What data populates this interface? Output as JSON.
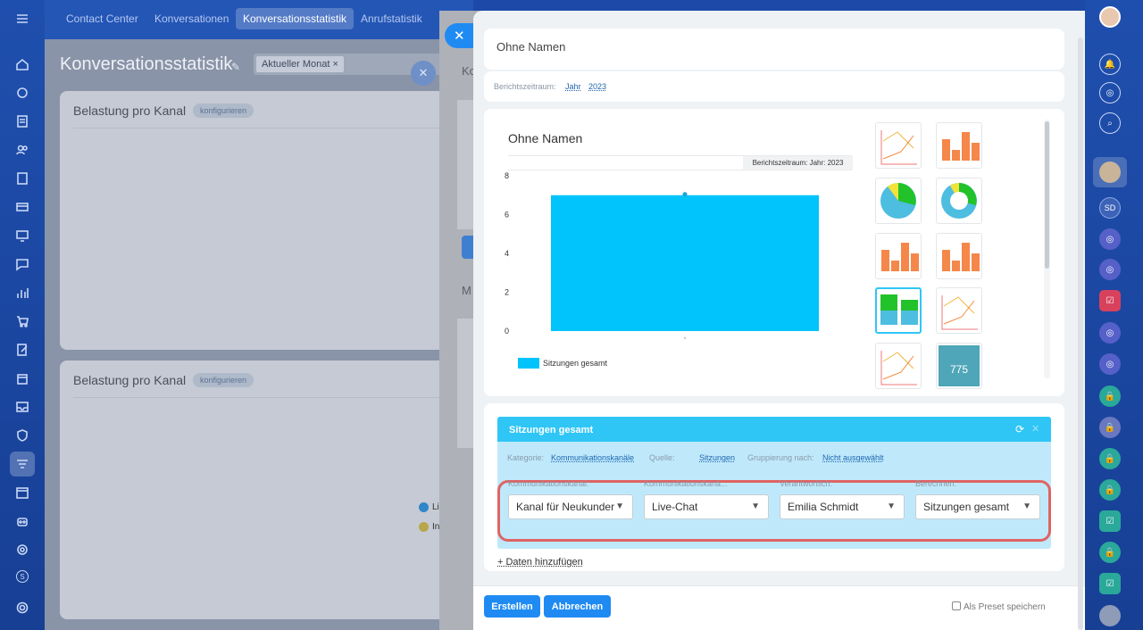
{
  "topnav": {
    "tabs": [
      {
        "label": "Contact Center"
      },
      {
        "label": "Konversationen"
      },
      {
        "label": "Konversationsstatistik"
      },
      {
        "label": "Anrufstatistik"
      }
    ]
  },
  "page": {
    "title": "Konversationsstatistik",
    "filter_chip": "Aktueller Monat",
    "panels": [
      {
        "title": "Belastung pro Kanal",
        "badge": "konfigurieren"
      },
      {
        "title": "Belastung pro Kanal",
        "badge": "konfigurieren"
      }
    ],
    "legend_partial": [
      "Li",
      "In"
    ],
    "behind_slider_letters": [
      "Ko",
      "M"
    ]
  },
  "report": {
    "name_input": "Ohne Namen",
    "period_label": "Berichtszeitraum:",
    "period_unit": "Jahr",
    "period_year": "2023"
  },
  "chart_data": {
    "type": "bar",
    "title": "Ohne Namen",
    "period_badge": "Berichtszeitraum: Jahr: 2023",
    "categories": [
      ","
    ],
    "series": [
      {
        "name": "Sitzungen gesamt",
        "values": [
          7
        ],
        "color": "#00c4fb"
      }
    ],
    "yticks": [
      0,
      2,
      4,
      6,
      8
    ],
    "ylim": [
      0,
      8
    ],
    "legend_position": "bottom-left"
  },
  "thumbnails": [
    {
      "type": "line"
    },
    {
      "type": "bar"
    },
    {
      "type": "pie"
    },
    {
      "type": "donut"
    },
    {
      "type": "bar"
    },
    {
      "type": "bar"
    },
    {
      "type": "stacked-bar",
      "selected": true
    },
    {
      "type": "line"
    },
    {
      "type": "line"
    },
    {
      "type": "number",
      "value": "775"
    }
  ],
  "dataset": {
    "title": "Sitzungen gesamt",
    "category_label": "Kategorie:",
    "category_value": "Kommunikationskanäle",
    "source_label": "Quelle:",
    "source_value": "Sitzungen",
    "grouping_label": "Gruppierung nach:",
    "grouping_value": "Nicht ausgewählt",
    "filters": [
      {
        "label": "Kommunikationskanal:",
        "value": "Kanal für Neukunder"
      },
      {
        "label": "Kommunikationskanä...",
        "value": "Live-Chat"
      },
      {
        "label": "Verantwortlich:",
        "value": "Emilia Schmidt"
      },
      {
        "label": "Berechnen:",
        "value": "Sitzungen gesamt"
      }
    ],
    "add_data": "+ Daten hinzufügen"
  },
  "footer": {
    "create": "Erstellen",
    "cancel": "Abbrechen",
    "preset": "Als Preset speichern"
  },
  "rightbar": {
    "avatar_initials": "SD",
    "counter": "S"
  },
  "colors": {
    "accent": "#1f8bf2",
    "bar": "#00c4fb",
    "highlight": "#e05a5a"
  }
}
